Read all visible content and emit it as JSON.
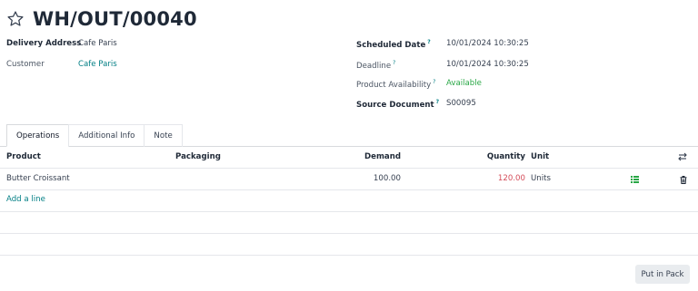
{
  "record": {
    "title": "WH/OUT/00040"
  },
  "fields": {
    "delivery_address_label": "Delivery Address",
    "delivery_address_value": "Cafe Paris",
    "customer_label": "Customer",
    "customer_value": "Cafe Paris",
    "scheduled_date_label": "Scheduled Date",
    "scheduled_date_value": "10/01/2024 10:30:25",
    "deadline_label": "Deadline",
    "deadline_value": "10/01/2024 10:30:25",
    "product_availability_label": "Product Availability",
    "product_availability_value": "Available",
    "source_document_label": "Source Document",
    "source_document_value": "S00095",
    "help_mark": "?"
  },
  "tabs": [
    {
      "label": "Operations"
    },
    {
      "label": "Additional Info"
    },
    {
      "label": "Note"
    }
  ],
  "table": {
    "headers": {
      "product": "Product",
      "packaging": "Packaging",
      "demand": "Demand",
      "quantity": "Quantity",
      "unit": "Unit"
    },
    "rows": [
      {
        "product": "Butter Croissant",
        "packaging": "",
        "demand": "100.00",
        "quantity": "120.00",
        "unit": "Units"
      }
    ],
    "add_line": "Add a line"
  },
  "footer": {
    "put_in_pack": "Put in Pack"
  },
  "colors": {
    "link": "#017e84",
    "available": "#28a745",
    "quantity_over": "#d44c59"
  }
}
